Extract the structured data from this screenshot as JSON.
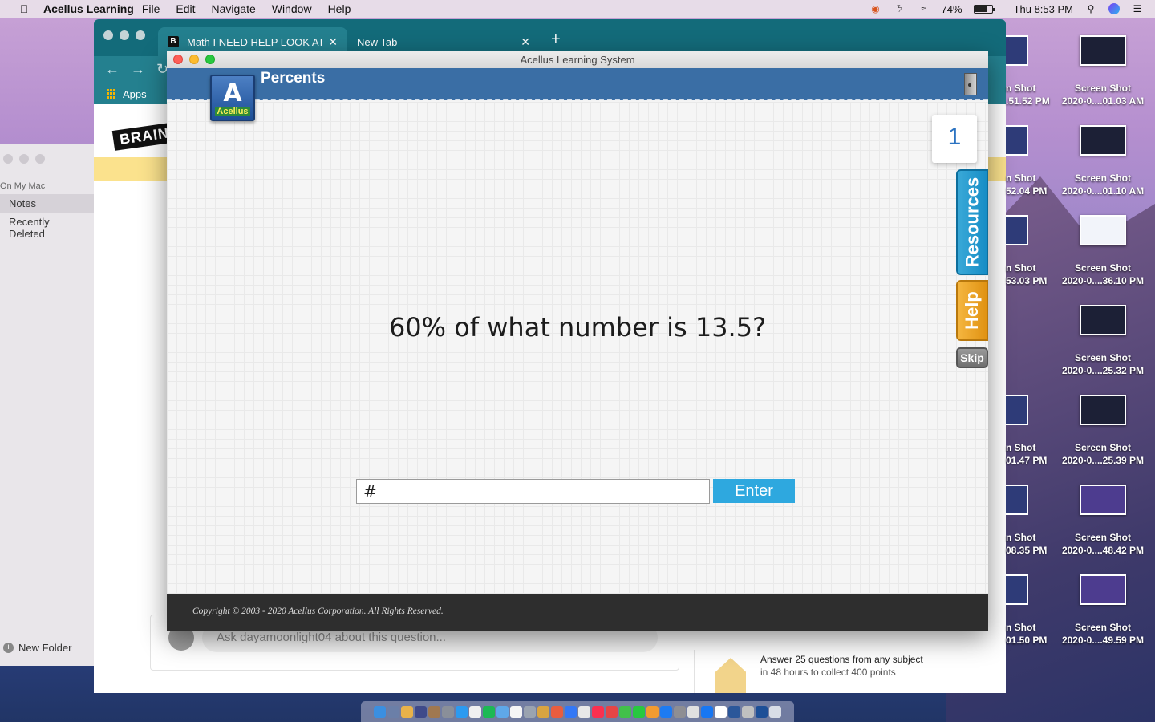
{
  "menubar": {
    "app_name": "Acellus Learning",
    "items": [
      "File",
      "Edit",
      "Navigate",
      "Window",
      "Help"
    ],
    "battery_percent": "74%",
    "battery_level": 0.74,
    "clock": "Thu 8:53 PM"
  },
  "notes": {
    "section": "On My Mac",
    "items": [
      "Notes",
      "Recently Deleted"
    ],
    "new_folder": "New Folder"
  },
  "browser": {
    "tabs": [
      {
        "label": "Math I NEED HELP LOOK AT TH",
        "favicon": "B"
      },
      {
        "label": "New Tab"
      }
    ],
    "new_tab": "+",
    "bookmarks_apps": "Apps",
    "page": {
      "logo": "BRAINLY",
      "comment_placeholder": "Ask dayamoonlight04 about this question...",
      "promo_line1": "Answer 25 questions from any subject",
      "promo_line2": "in 48 hours to collect 400 points"
    }
  },
  "acellus": {
    "window_title": "Acellus Learning System",
    "logo_glyph": "A",
    "logo_text": "Acellus",
    "lesson_title": "Percents",
    "question_counter": "1",
    "resources_label": "Resources",
    "help_label": "Help",
    "skip_label": "Skip",
    "question": "60% of what number is 13.5?",
    "answer_value": "#",
    "enter_label": "Enter",
    "copyright": "Copyright © 2003 - 2020 Acellus Corporation.  All Rights Reserved."
  },
  "desktop": {
    "right_icons": [
      {
        "line1": "Screen Shot",
        "line2": "2020-0....01.03 AM"
      },
      {
        "line1": "Screen Shot",
        "line2": "2020-0....01.10 AM"
      },
      {
        "line1": "Screen Shot",
        "line2": "2020-0....36.10 PM"
      },
      {
        "line1": "Screen Shot",
        "line2": "2020-0....25.32 PM"
      },
      {
        "line1": "Screen Shot",
        "line2": "2020-0....25.39 PM"
      },
      {
        "line1": "Screen Shot",
        "line2": "2020-0....48.42 PM"
      },
      {
        "line1": "Screen Shot",
        "line2": "2020-0....49.59 PM"
      }
    ],
    "partial_icons": [
      {
        "line1": "n Shot",
        "line2": ".51.52 PM"
      },
      {
        "line1": "n Shot",
        "line2": "52.04 PM"
      },
      {
        "line1": "n Shot",
        "line2": "53.03 PM"
      },
      {
        "line1": "n Shot",
        "line2": "01.47 PM"
      },
      {
        "line1": "n Shot",
        "line2": "08.35 PM"
      },
      {
        "line1": "n Shot",
        "line2": "01.50 PM"
      }
    ]
  },
  "colors": {
    "acellus_header": "#3a6ea5",
    "enter_button": "#2ea8df",
    "resources_tab": "#168dc6",
    "help_tab": "#e09212",
    "chrome_tabbar": "#136b7a"
  }
}
